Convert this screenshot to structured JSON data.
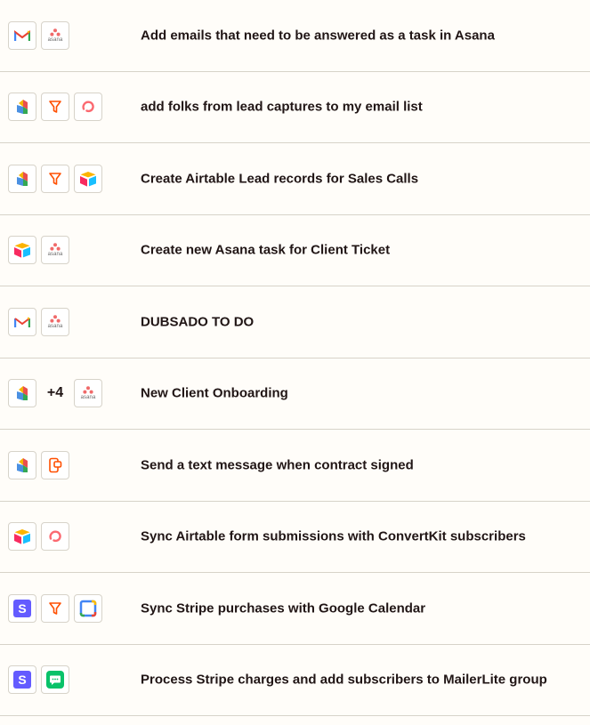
{
  "zaps": [
    {
      "title": "Add emails that need to be answered as a task in Asana",
      "icons": [
        "gmail-icon",
        "asana-icon"
      ],
      "more": ""
    },
    {
      "title": "add folks from lead captures to my email list",
      "icons": [
        "dubsado-icon",
        "filter-icon",
        "convertkit-icon"
      ],
      "more": ""
    },
    {
      "title": "Create Airtable Lead records for Sales Calls",
      "icons": [
        "dubsado-icon",
        "filter-icon",
        "airtable-icon"
      ],
      "more": ""
    },
    {
      "title": "Create new Asana task for Client Ticket",
      "icons": [
        "airtable-icon",
        "asana-icon"
      ],
      "more": ""
    },
    {
      "title": "DUBSADO TO DO",
      "icons": [
        "gmail-icon",
        "asana-icon"
      ],
      "more": ""
    },
    {
      "title": "New Client Onboarding",
      "icons": [
        "dubsado-icon",
        "asana-icon"
      ],
      "more": "+4"
    },
    {
      "title": "Send a text message when contract signed",
      "icons": [
        "dubsado-icon",
        "sms-icon"
      ],
      "more": ""
    },
    {
      "title": "Sync Airtable form submissions with ConvertKit subscribers",
      "icons": [
        "airtable-icon",
        "convertkit-icon"
      ],
      "more": ""
    },
    {
      "title": "Sync Stripe purchases with Google Calendar",
      "icons": [
        "stripe-icon",
        "filter-icon",
        "google-calendar-icon"
      ],
      "more": ""
    },
    {
      "title": "Process Stripe charges and add subscribers to MailerLite group",
      "icons": [
        "stripe-icon",
        "mailerlite-icon"
      ],
      "more": ""
    }
  ],
  "asana_wordmark": "asana",
  "stripe_letter": "S",
  "colors": {
    "background": "#fffdf9",
    "divider": "#d7d3c9",
    "text": "#201515",
    "zapier_orange": "#ff4f00",
    "convertkit_red": "#fb6970",
    "stripe_purple": "#635bff",
    "mailerlite_green": "#09c269"
  }
}
